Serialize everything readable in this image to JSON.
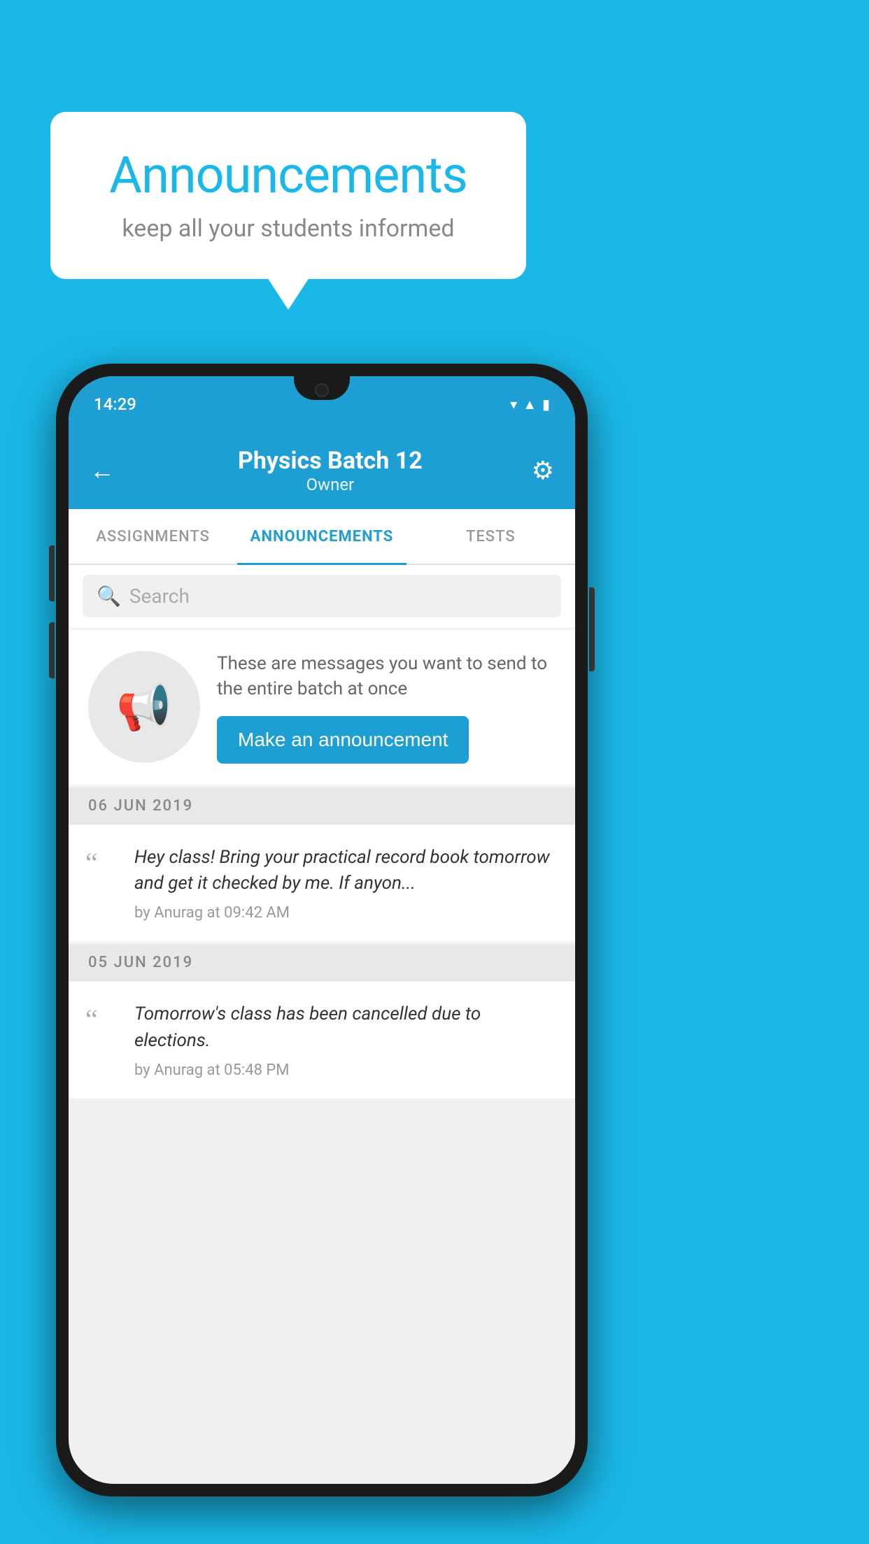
{
  "background_color": "#1ab8e8",
  "speech_bubble": {
    "title": "Announcements",
    "subtitle": "keep all your students informed"
  },
  "phone": {
    "status_bar": {
      "time": "14:29"
    },
    "app_bar": {
      "title": "Physics Batch 12",
      "subtitle": "Owner",
      "back_icon": "←",
      "gear_icon": "⚙"
    },
    "tabs": [
      {
        "label": "ASSIGNMENTS",
        "active": false
      },
      {
        "label": "ANNOUNCEMENTS",
        "active": true
      },
      {
        "label": "TESTS",
        "active": false
      }
    ],
    "search": {
      "placeholder": "Search"
    },
    "promo": {
      "description": "These are messages you want to send to the entire batch at once",
      "button_label": "Make an announcement"
    },
    "date_groups": [
      {
        "date": "06  JUN  2019",
        "announcements": [
          {
            "message": "Hey class! Bring your practical record book tomorrow and get it checked by me. If anyon...",
            "meta": "by Anurag at 09:42 AM"
          }
        ]
      },
      {
        "date": "05  JUN  2019",
        "announcements": [
          {
            "message": "Tomorrow's class has been cancelled due to elections.",
            "meta": "by Anurag at 05:48 PM"
          }
        ]
      }
    ]
  }
}
